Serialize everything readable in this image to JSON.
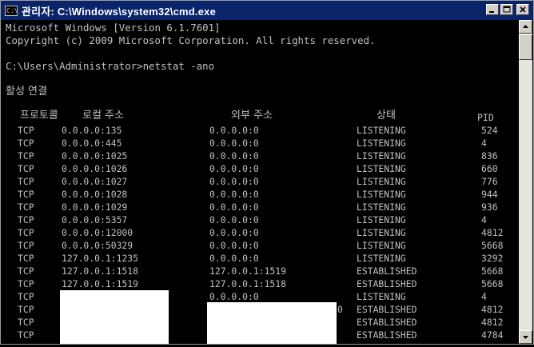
{
  "window": {
    "title": "관리자: C:\\Windows\\system32\\cmd.exe",
    "icon": "cmd-icon",
    "controls": {
      "minimize": "_",
      "maximize": "□",
      "close": "×"
    }
  },
  "console": {
    "banner_line1": "Microsoft Windows [Version 6.1.7601]",
    "banner_line2": "Copyright (c) 2009 Microsoft Corporation. All rights reserved.",
    "prompt_line": "C:\\Users\\Administrator>netstat -ano",
    "section_title": "활성 연결",
    "columns": {
      "proto": "프로토콜",
      "local": "로컬 주소",
      "foreign": "외부 주소",
      "state": "상태",
      "pid": "PID"
    },
    "rows": [
      {
        "proto": "TCP",
        "local": "0.0.0.0:135",
        "foreign": "0.0.0.0:0",
        "state": "LISTENING",
        "pid": "524"
      },
      {
        "proto": "TCP",
        "local": "0.0.0.0:445",
        "foreign": "0.0.0.0:0",
        "state": "LISTENING",
        "pid": "4"
      },
      {
        "proto": "TCP",
        "local": "0.0.0.0:1025",
        "foreign": "0.0.0.0:0",
        "state": "LISTENING",
        "pid": "836"
      },
      {
        "proto": "TCP",
        "local": "0.0.0.0:1026",
        "foreign": "0.0.0.0:0",
        "state": "LISTENING",
        "pid": "660"
      },
      {
        "proto": "TCP",
        "local": "0.0.0.0:1027",
        "foreign": "0.0.0.0:0",
        "state": "LISTENING",
        "pid": "776"
      },
      {
        "proto": "TCP",
        "local": "0.0.0.0:1028",
        "foreign": "0.0.0.0:0",
        "state": "LISTENING",
        "pid": "944"
      },
      {
        "proto": "TCP",
        "local": "0.0.0.0:1029",
        "foreign": "0.0.0.0:0",
        "state": "LISTENING",
        "pid": "936"
      },
      {
        "proto": "TCP",
        "local": "0.0.0.0:5357",
        "foreign": "0.0.0.0:0",
        "state": "LISTENING",
        "pid": "4"
      },
      {
        "proto": "TCP",
        "local": "0.0.0.0:12000",
        "foreign": "0.0.0.0:0",
        "state": "LISTENING",
        "pid": "4812"
      },
      {
        "proto": "TCP",
        "local": "0.0.0.0:50329",
        "foreign": "0.0.0.0:0",
        "state": "LISTENING",
        "pid": "5668"
      },
      {
        "proto": "TCP",
        "local": "127.0.0.1:1235",
        "foreign": "0.0.0.0:0",
        "state": "LISTENING",
        "pid": "3292"
      },
      {
        "proto": "TCP",
        "local": "127.0.0.1:1518",
        "foreign": "127.0.0.1:1519",
        "state": "ESTABLISHED",
        "pid": "5668"
      },
      {
        "proto": "TCP",
        "local": "127.0.0.1:1519",
        "foreign": "127.0.0.1:1518",
        "state": "ESTABLISHED",
        "pid": "5668"
      },
      {
        "proto": "TCP",
        "local": "",
        "foreign": "0.0.0.0:0",
        "state": "LISTENING",
        "pid": "4"
      },
      {
        "proto": "TCP",
        "local": "",
        "foreign": "0",
        "state": "ESTABLISHED",
        "pid": "4812"
      },
      {
        "proto": "TCP",
        "local": "",
        "foreign": "",
        "state": "ESTABLISHED",
        "pid": "4812"
      },
      {
        "proto": "TCP",
        "local": "",
        "foreign": "",
        "state": "ESTABLISHED",
        "pid": "4784"
      }
    ]
  },
  "colors": {
    "console_bg": "#000000",
    "console_text": "#c0c0c0",
    "titlebar": "#0a246a",
    "redaction": "#ffffff"
  }
}
